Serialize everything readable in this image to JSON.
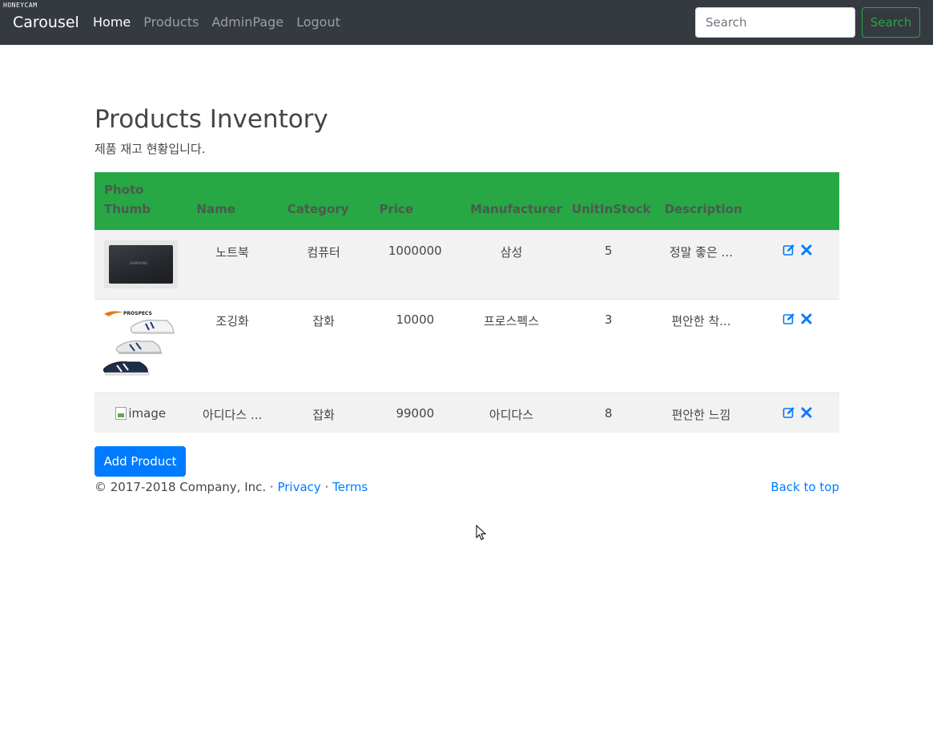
{
  "watermark": "HONEYCAM",
  "navbar": {
    "brand": "Carousel",
    "links": [
      "Home",
      "Products",
      "AdminPage",
      "Logout"
    ],
    "search_placeholder": "Search",
    "search_button": "Search"
  },
  "page": {
    "title": "Products Inventory",
    "subtitle": "제품 재고 현황입니다."
  },
  "table": {
    "headers": [
      "Photo Thumb",
      "Name",
      "Category",
      "Price",
      "Manufacturer",
      "UnitInStock",
      "Description",
      ""
    ],
    "header_color": "#28a745",
    "rows": [
      {
        "photo": "laptop-photo",
        "name": "노트북",
        "category": "컴퓨터",
        "price": "1000000",
        "manufacturer": "삼성",
        "stock": "5",
        "description": "정말 좋은 ..."
      },
      {
        "photo": "shoes-photo",
        "name": "조깅화",
        "category": "잡화",
        "price": "10000",
        "manufacturer": "프로스펙스",
        "stock": "3",
        "description": "편안한 착..."
      },
      {
        "photo": "broken-image",
        "photo_alt": "image",
        "name": "아디다스 ...",
        "category": "잡화",
        "price": "99000",
        "manufacturer": "아디다스",
        "stock": "8",
        "description": "편안한 느낌"
      }
    ]
  },
  "add_button": "Add Product",
  "footer": {
    "copyright": "© 2017-2018 Company, Inc. · ",
    "privacy": "Privacy",
    "separator": " · ",
    "terms": "Terms",
    "back_to_top": "Back to top"
  },
  "colors": {
    "navbar": "#343a40",
    "primary": "#007bff",
    "success": "#28a745"
  }
}
